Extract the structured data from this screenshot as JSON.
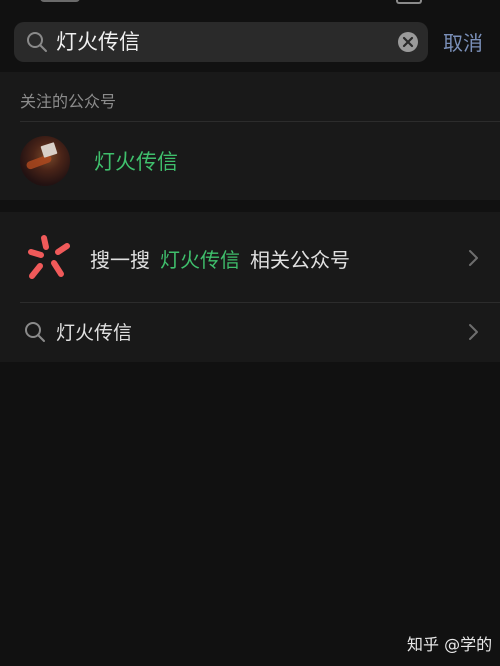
{
  "search": {
    "query": "灯火传信",
    "cancel_label": "取消"
  },
  "followed_section": {
    "title": "关注的公众号",
    "accounts": [
      {
        "name": "灯火传信"
      }
    ]
  },
  "search_section": {
    "sousou": {
      "prefix": "搜一搜",
      "keyword": "灯火传信",
      "suffix": "相关公众号"
    },
    "query_suggestion": "灯火传信"
  },
  "watermark": "知乎 @学的",
  "colors": {
    "background": "#111111",
    "panel": "#191919",
    "highlight_green": "#3fbf6c",
    "cancel_blue": "#7a8fb8",
    "sousou_red": "#f05a5a"
  },
  "icons": {
    "search": "search-icon",
    "clear": "clear-icon",
    "chevron": "chevron-right-icon",
    "sousou": "sousou-logo-icon"
  }
}
